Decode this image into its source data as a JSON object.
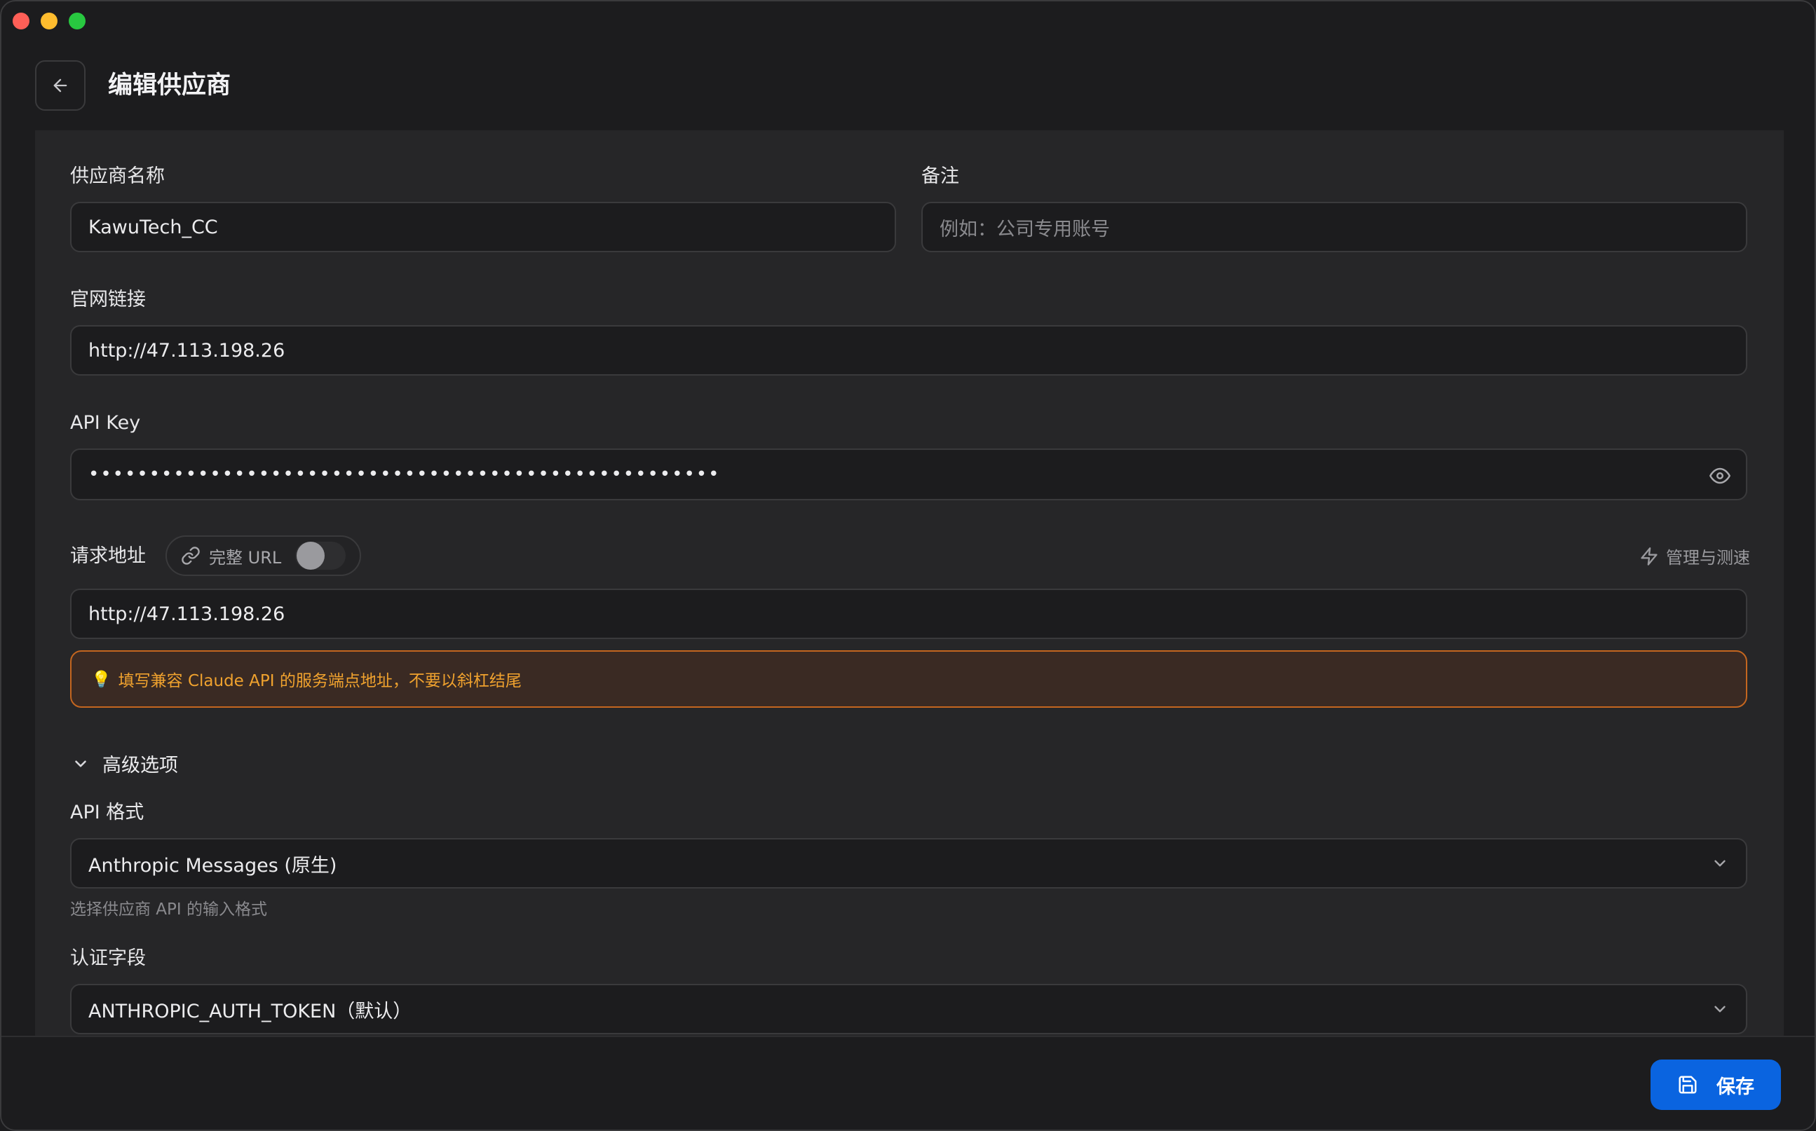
{
  "header": {
    "title": "编辑供应商"
  },
  "form": {
    "provider_name": {
      "label": "供应商名称",
      "value": "KawuTech_CC"
    },
    "note": {
      "label": "备注",
      "placeholder": "例如：公司专用账号"
    },
    "website": {
      "label": "官网链接",
      "value": "http://47.113.198.26"
    },
    "api_key": {
      "label": "API Key",
      "masked_value": "••••••••••••••••••••••••••••••••••••••••••••••••••••"
    },
    "request_url": {
      "label": "请求地址",
      "full_url_label": "完整 URL",
      "full_url_enabled": false,
      "manage_label": "管理与测速",
      "value": "http://47.113.198.26",
      "hint_emoji": "💡",
      "hint": "填写兼容 Claude API 的服务端点地址，不要以斜杠结尾"
    },
    "advanced": {
      "toggle_label": "高级选项",
      "api_format": {
        "label": "API 格式",
        "selected": "Anthropic Messages (原生)",
        "help": "选择供应商 API 的输入格式"
      },
      "auth_field": {
        "label": "认证字段",
        "selected": "ANTHROPIC_AUTH_TOKEN（默认）"
      }
    }
  },
  "footer": {
    "save_label": "保存"
  },
  "colors": {
    "accent": "#0a64e0",
    "warning_border": "#c4661f",
    "warning_text": "#f0a22e"
  }
}
